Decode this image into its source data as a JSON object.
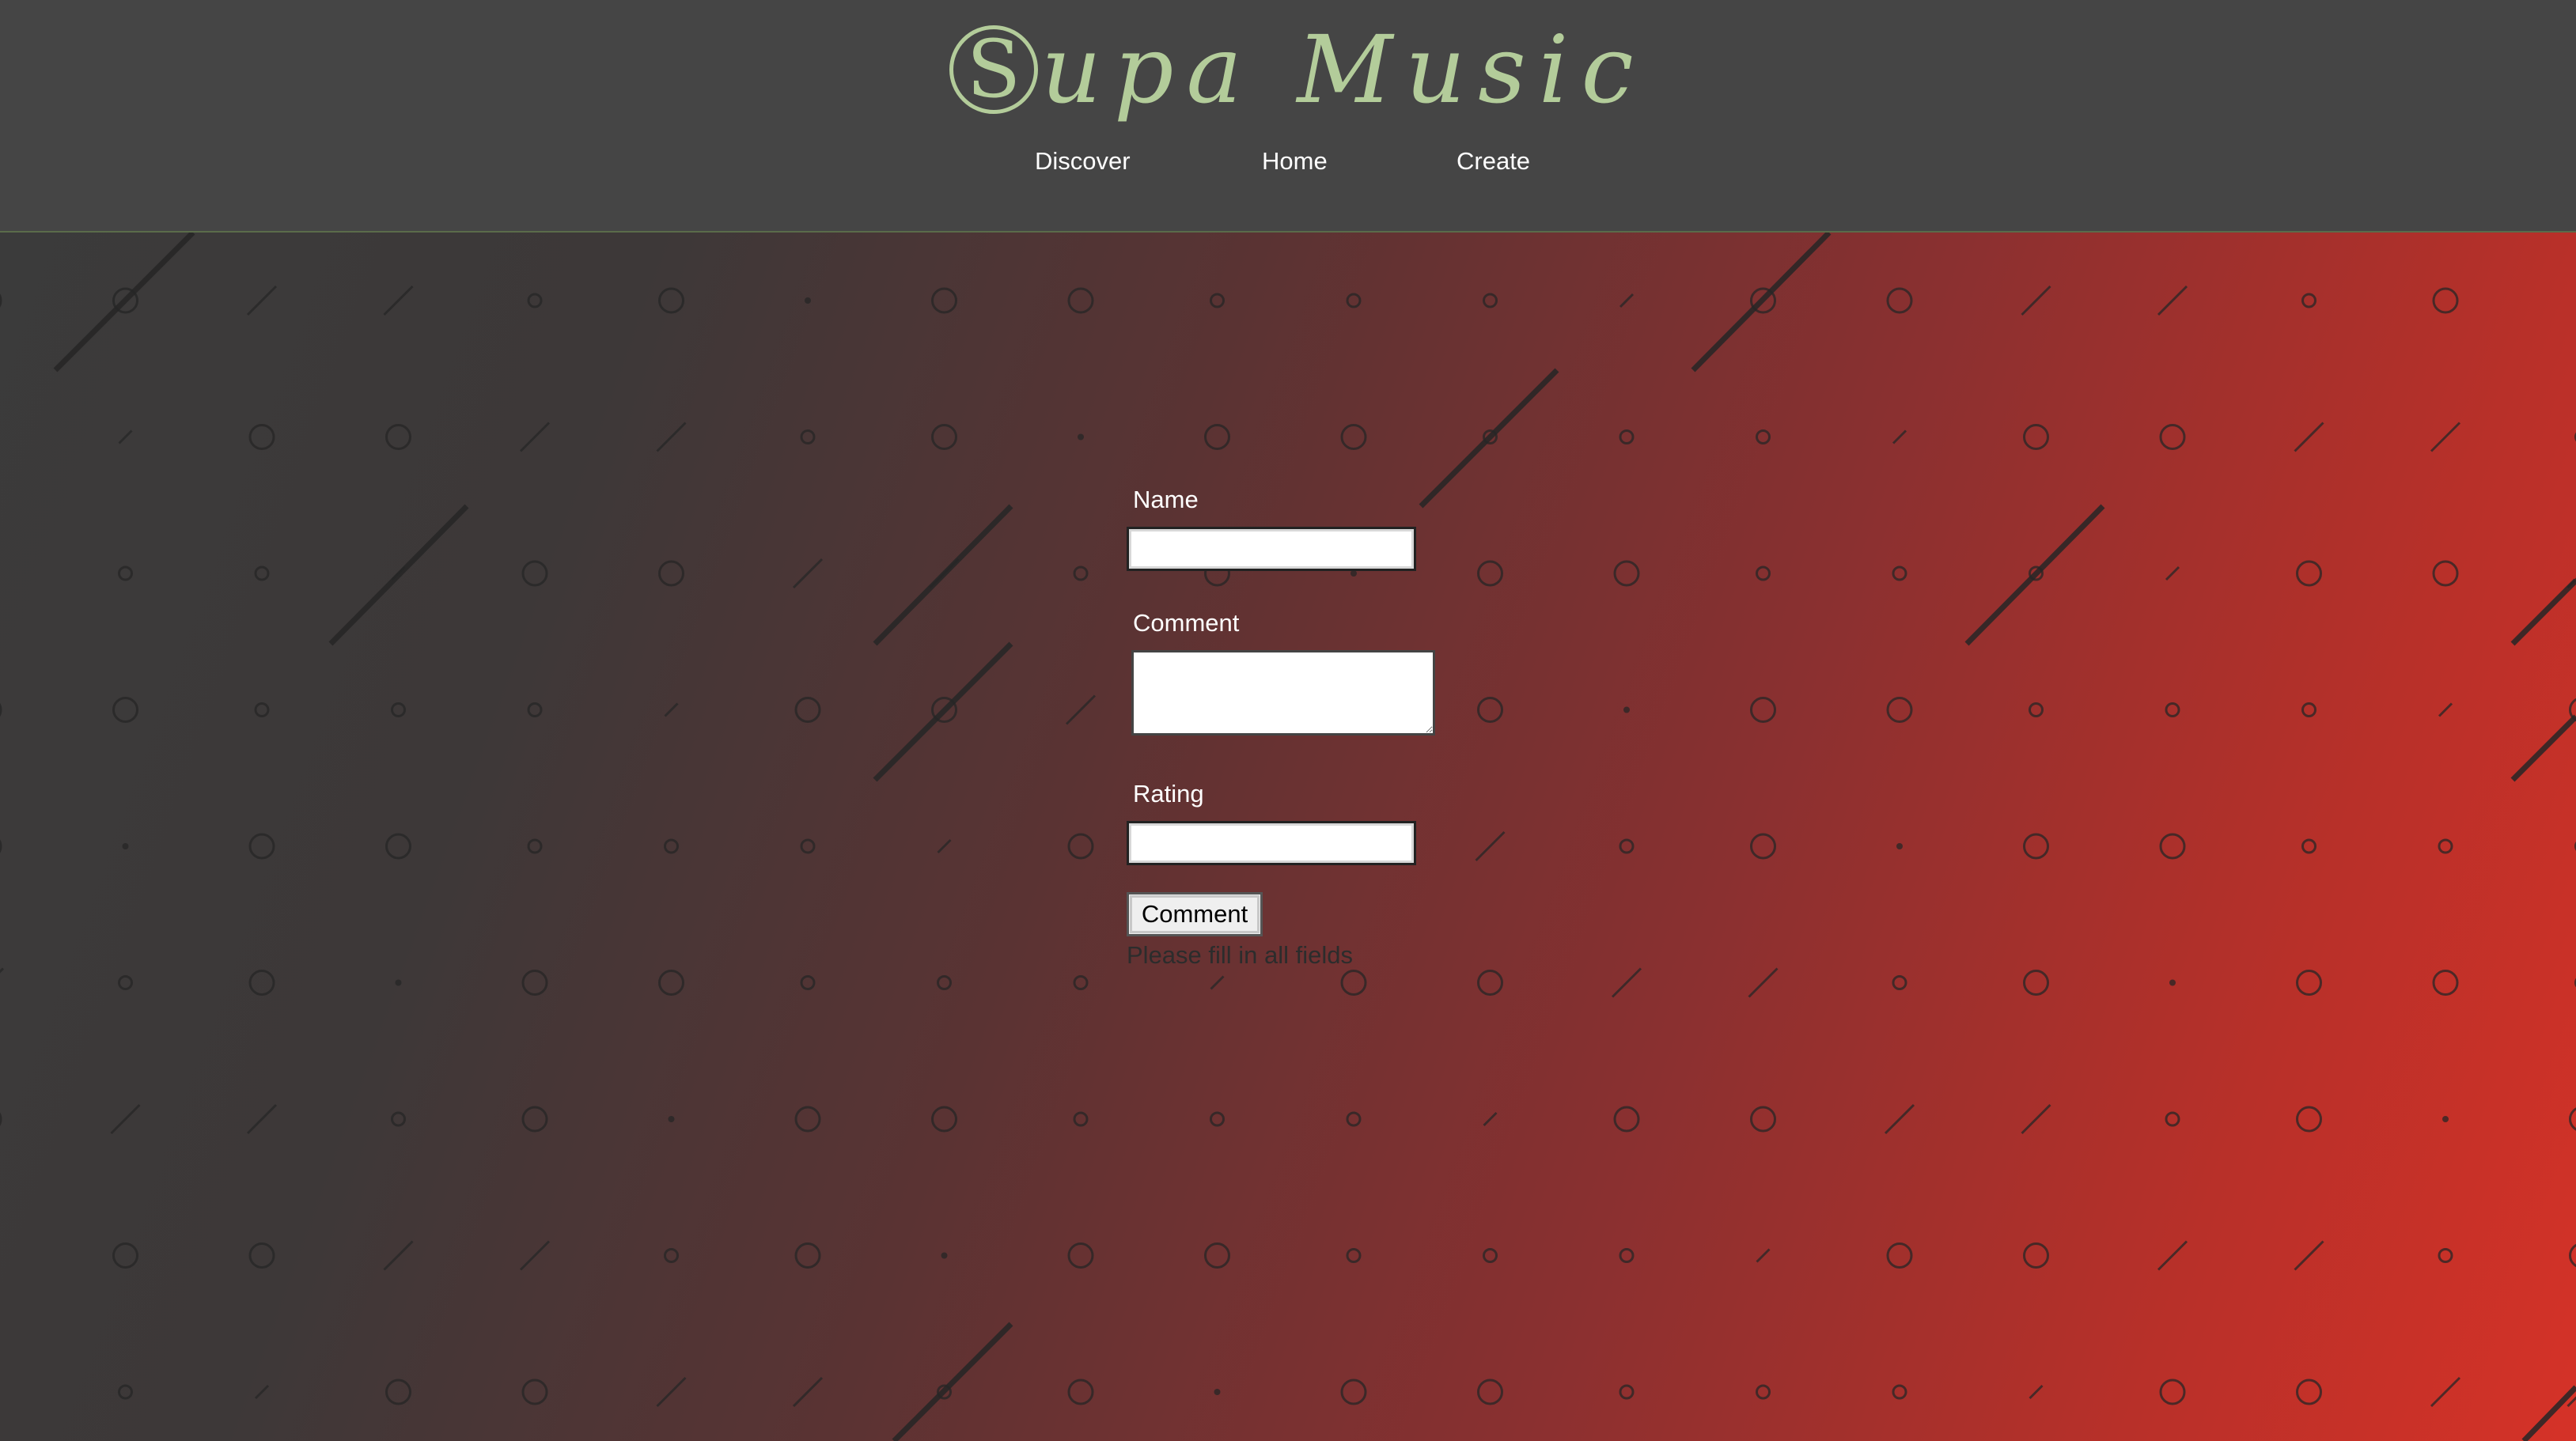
{
  "header": {
    "logo_initial": "S",
    "logo_rest": "upa Music",
    "nav": {
      "discover": "Discover",
      "home": "Home",
      "create": "Create"
    }
  },
  "form": {
    "name_label": "Name",
    "name_value": "",
    "comment_label": "Comment",
    "comment_value": "",
    "rating_label": "Rating",
    "rating_value": "",
    "submit_label": "Comment",
    "status_message": "Please fill in all fields"
  },
  "colors": {
    "header_bg": "#454545",
    "logo": "#b3cc9a",
    "gradient_start": "#3b3b3b",
    "gradient_end": "#d53228",
    "pattern_stroke": "#262626"
  }
}
